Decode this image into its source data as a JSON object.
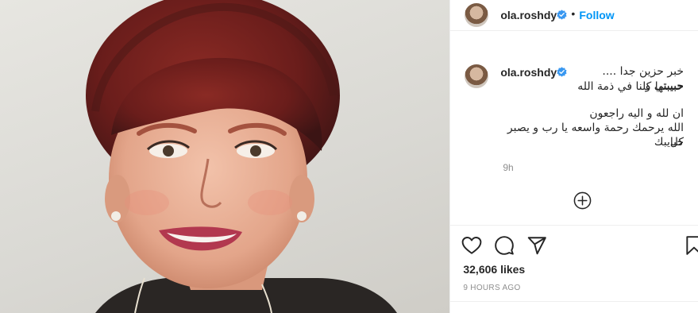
{
  "post": {
    "username": "ola.roshdy",
    "dot": "•",
    "follow_label": "Follow",
    "caption": {
      "line1": "خبر حزين جدا .... حبيبتي و",
      "line2": "حبيبتها كلنا في ذمة الله",
      "line3": "ان لله و اليه راجعون",
      "line4": "الله يرحمك رحمة واسعه يا رب و يصبر كل",
      "line5": "حبايبك"
    },
    "time": "9h",
    "likes": "32,606 likes",
    "ago": "9 HOURS AGO"
  },
  "icons": {
    "verified": "verified-badge-icon",
    "add_comment": "plus-circle-icon",
    "like": "heart-icon",
    "comment": "comment-bubble-icon",
    "share": "paper-plane-icon",
    "save": "bookmark-icon"
  },
  "colors": {
    "accent": "#0095f6",
    "text": "#262626",
    "muted": "#8e8e8e",
    "border": "#efefef"
  }
}
